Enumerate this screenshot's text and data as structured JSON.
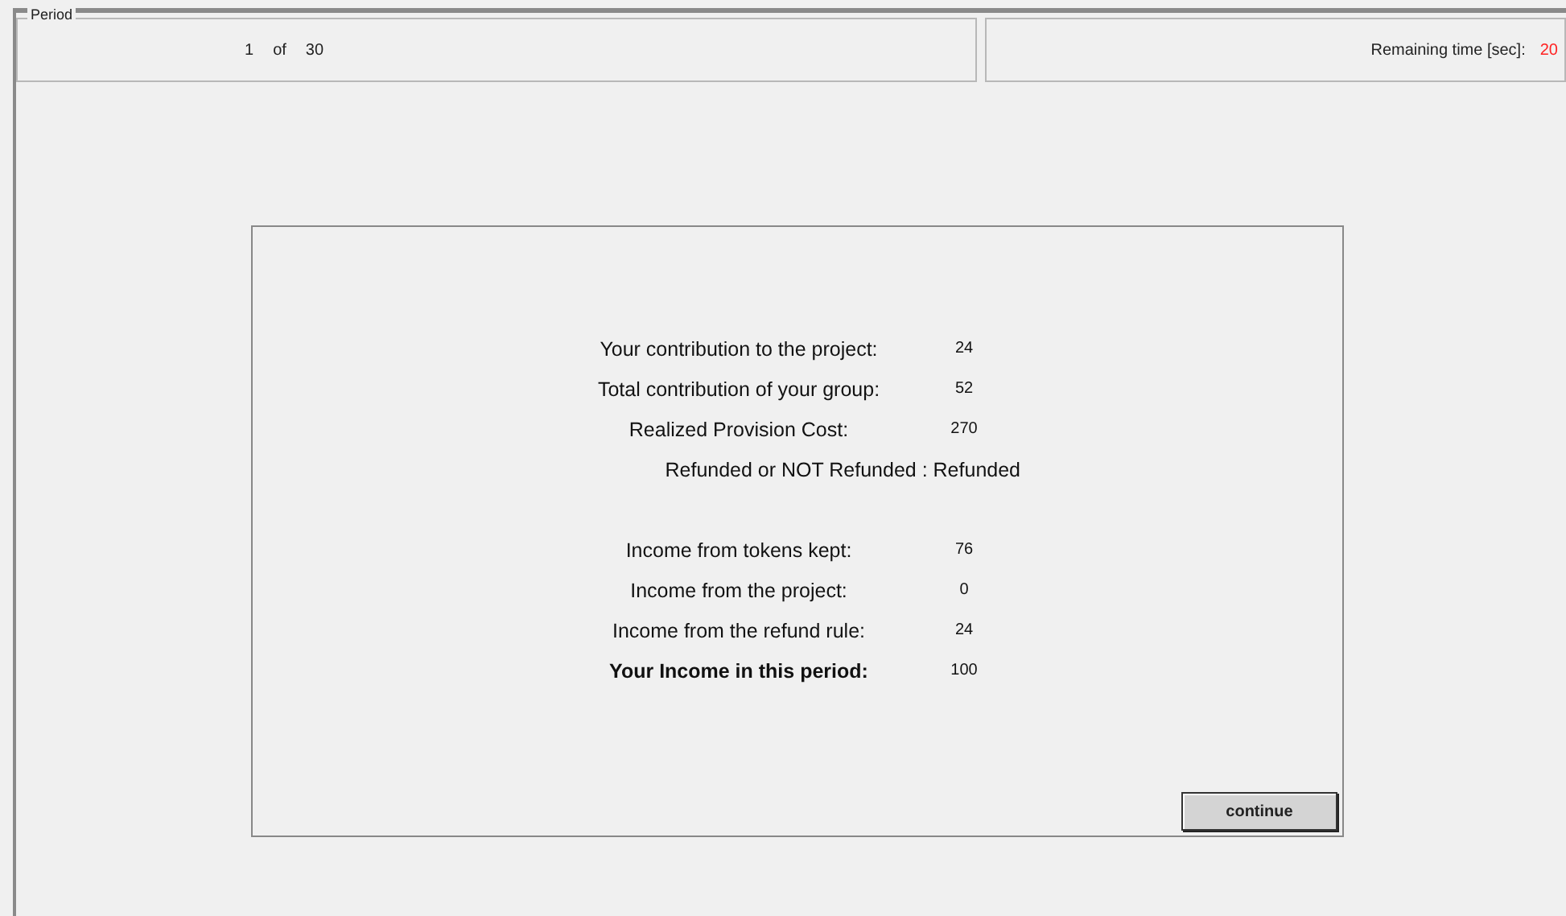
{
  "period": {
    "legend": "Period",
    "current": "1",
    "of": "of",
    "total": "30"
  },
  "timer": {
    "label": "Remaining time [sec]:",
    "value": "20"
  },
  "sections": [
    {
      "rows": [
        {
          "kind": "pair",
          "label": "Your contribution to the project:",
          "value": "24",
          "bold": false
        },
        {
          "kind": "pair",
          "label": "Total contribution of your group:",
          "value": "52",
          "bold": false
        },
        {
          "kind": "pair",
          "label": "Realized Provision Cost:",
          "value": "270",
          "bold": false
        },
        {
          "kind": "line",
          "label": "Refunded or NOT Refunded : Refunded"
        }
      ]
    },
    {
      "rows": [
        {
          "kind": "pair",
          "label": "Income from tokens kept:",
          "value": "76",
          "bold": false
        },
        {
          "kind": "pair",
          "label": "Income from the project:",
          "value": "0",
          "bold": false
        },
        {
          "kind": "pair",
          "label": "Income from the refund rule:",
          "value": "24",
          "bold": false
        },
        {
          "kind": "pair",
          "label": "Your Income in this period:",
          "value": "100",
          "bold": true
        }
      ]
    }
  ],
  "button": "continue"
}
